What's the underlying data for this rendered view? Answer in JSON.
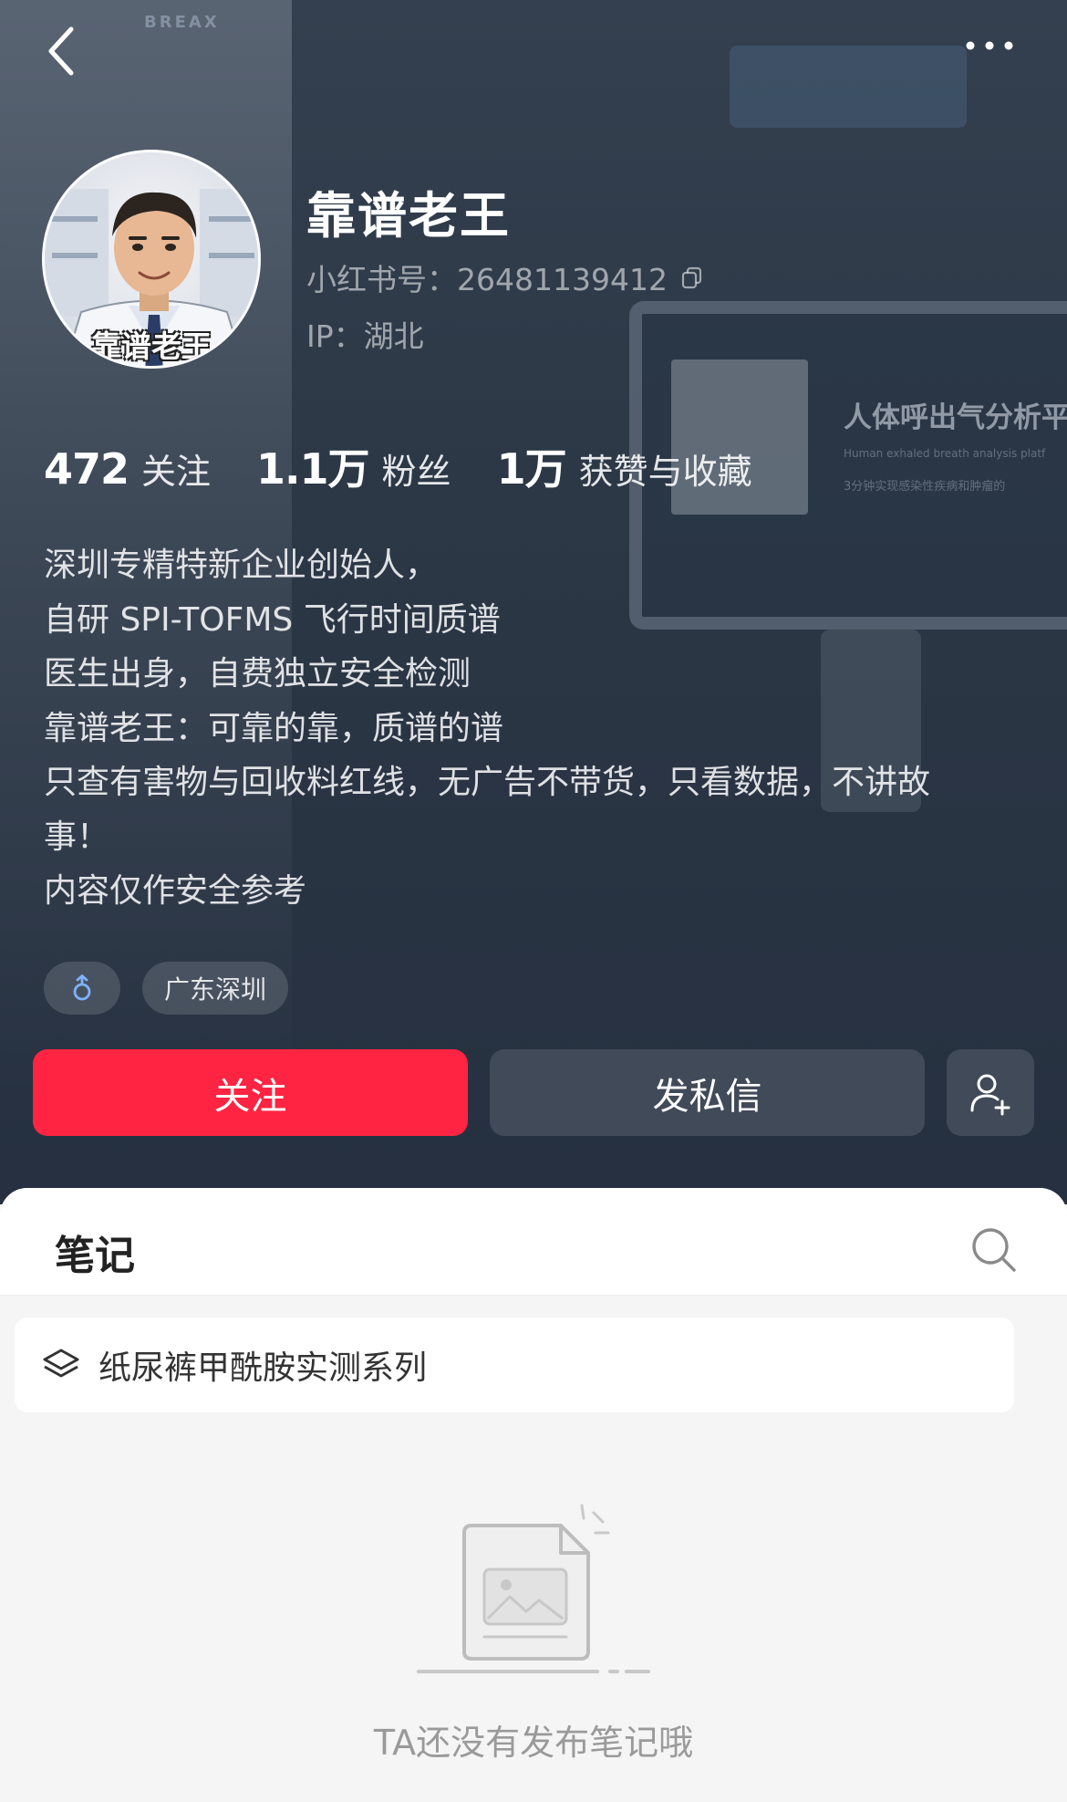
{
  "background": {
    "brand": "BREAX",
    "screen_title": "人体呼出气分析平",
    "screen_subtitle": "Human exhaled breath analysis platf",
    "screen_subtitle2": "3分钟实现感染性疾病和肿瘤的"
  },
  "profile": {
    "avatar_label": "靠谱老王",
    "name": "靠谱老王",
    "red_id": "小红书号：26481139412",
    "ip": "IP：湖北"
  },
  "stats": [
    {
      "value": "472",
      "label": "关注"
    },
    {
      "value": "1.1万",
      "label": "粉丝"
    },
    {
      "value": "1万",
      "label": "获赞与收藏"
    }
  ],
  "bio": [
    "深圳专精特新企业创始人，",
    "自研 SPI-TOFMS 飞行时间质谱",
    "医生出身，自费独立安全检测",
    "靠谱老王：可靠的靠，质谱的谱",
    "只查有害物与回收料红线，无广告不带货，只看数据，不讲故",
    "事！",
    "内容仅作安全参考"
  ],
  "tags": {
    "gender_icon": "male-icon",
    "location": "广东深圳"
  },
  "actions": {
    "follow_label": "关注",
    "message_label": "发私信"
  },
  "notes": {
    "tab_title": "笔记",
    "collection_label": "纸尿裤甲酰胺实测系列",
    "empty_text": "TA还没有发布笔记哦"
  },
  "colors": {
    "accent": "#ff2442",
    "hero_bg": "#2d3947",
    "gender_icon": "#7fb2ff"
  }
}
